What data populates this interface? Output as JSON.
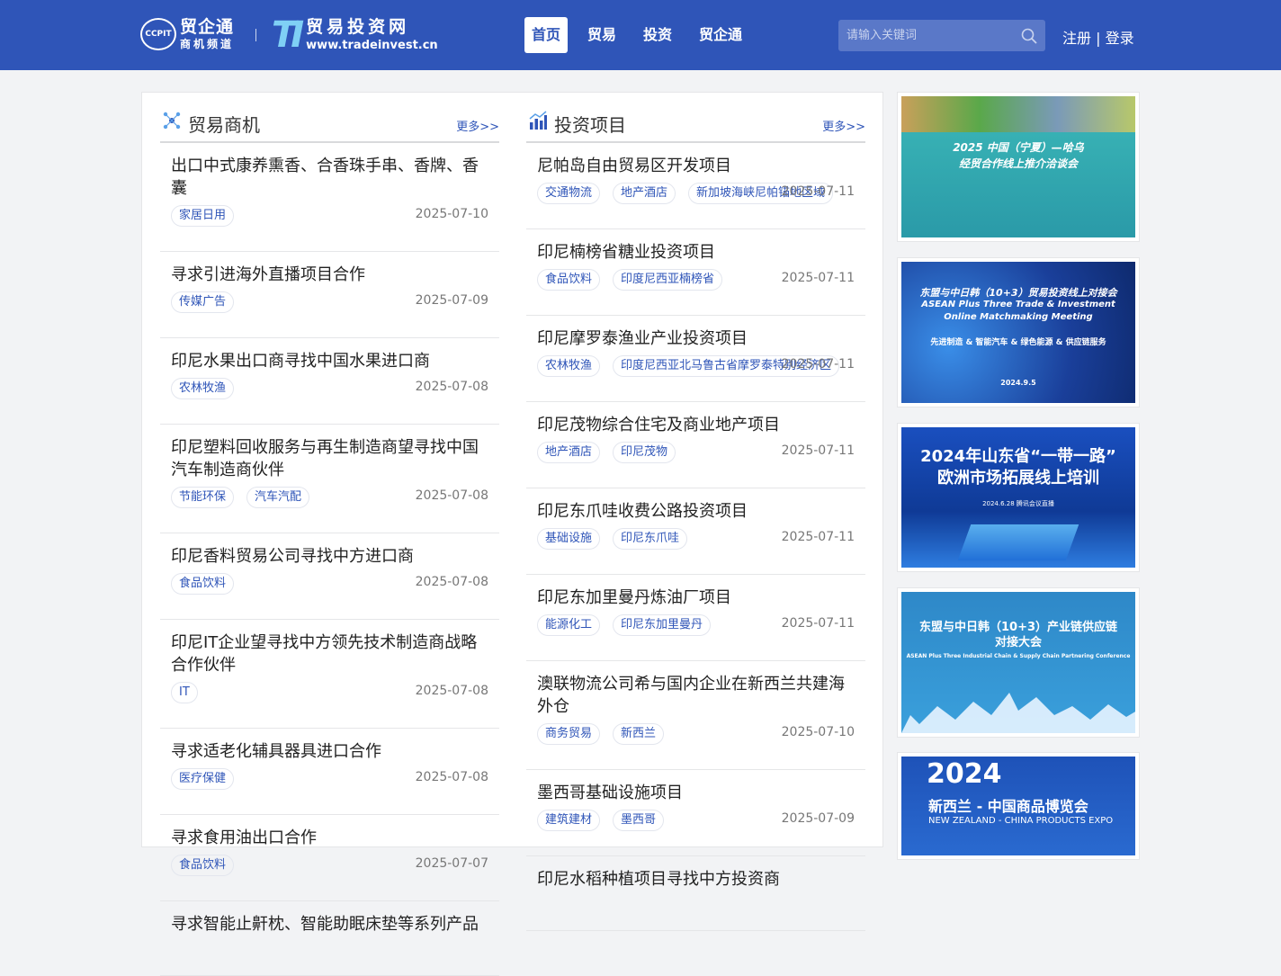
{
  "header": {
    "logo1_title": "贸企通",
    "logo1_sub": "商机频道",
    "logo1_badge": "CCPIT",
    "logo2_mark": "TI",
    "logo2_title": "贸易投资网",
    "logo2_url": "www.tradeinvest.cn",
    "nav": [
      "首页",
      "贸易",
      "投资",
      "贸企通"
    ],
    "search_placeholder": "请输入关键词",
    "register": "注册",
    "divider": "|",
    "login": "登录"
  },
  "trade": {
    "title": "贸易商机",
    "more": "更多>>",
    "items": [
      {
        "title": "出口中式康养熏香、合香珠手串、香牌、香囊",
        "tags": [
          "家居日用"
        ],
        "date": "2025-07-10"
      },
      {
        "title": "寻求引进海外直播项目合作",
        "tags": [
          "传媒广告"
        ],
        "date": "2025-07-09"
      },
      {
        "title": "印尼水果出口商寻找中国水果进口商",
        "tags": [
          "农林牧渔"
        ],
        "date": "2025-07-08"
      },
      {
        "title": "印尼塑料回收服务与再生制造商望寻找中国汽车制造商伙伴",
        "tags": [
          "节能环保",
          "汽车汽配"
        ],
        "date": "2025-07-08"
      },
      {
        "title": "印尼香料贸易公司寻找中方进口商",
        "tags": [
          "食品饮料"
        ],
        "date": "2025-07-08"
      },
      {
        "title": "印尼IT企业望寻找中方领先技术制造商战略合作伙伴",
        "tags": [
          "IT"
        ],
        "date": "2025-07-08"
      },
      {
        "title": "寻求适老化辅具器具进口合作",
        "tags": [
          "医疗保健"
        ],
        "date": "2025-07-08"
      },
      {
        "title": "寻求食用油出口合作",
        "tags": [
          "食品饮料"
        ],
        "date": "2025-07-07"
      },
      {
        "title": "寻求智能止鼾枕、智能助眠床垫等系列产品",
        "tags": [],
        "date": ""
      }
    ]
  },
  "invest": {
    "title": "投资项目",
    "more": "更多>>",
    "items": [
      {
        "title": "尼帕岛自由贸易区开发项目",
        "tags": [
          "交通物流",
          "地产酒店",
          "新加坡海峡尼帕锚地区域"
        ],
        "date": "2025-07-11"
      },
      {
        "title": "印尼楠榜省糖业投资项目",
        "tags": [
          "食品饮料",
          "印度尼西亚楠榜省"
        ],
        "date": "2025-07-11"
      },
      {
        "title": "印尼摩罗泰渔业产业投资项目",
        "tags": [
          "农林牧渔",
          "印度尼西亚北马鲁古省摩罗泰特别经济区"
        ],
        "date": "2025-07-11"
      },
      {
        "title": "印尼茂物综合住宅及商业地产项目",
        "tags": [
          "地产酒店",
          "印尼茂物"
        ],
        "date": "2025-07-11"
      },
      {
        "title": "印尼东爪哇收费公路投资项目",
        "tags": [
          "基础设施",
          "印尼东爪哇"
        ],
        "date": "2025-07-11"
      },
      {
        "title": "印尼东加里曼丹炼油厂项目",
        "tags": [
          "能源化工",
          "印尼东加里曼丹"
        ],
        "date": "2025-07-11"
      },
      {
        "title": "澳联物流公司希与国内企业在新西兰共建海外仓",
        "tags": [
          "商务贸易",
          "新西兰"
        ],
        "date": "2025-07-10"
      },
      {
        "title": "墨西哥基础设施项目",
        "tags": [
          "建筑建材",
          "墨西哥"
        ],
        "date": "2025-07-09"
      },
      {
        "title": "印尼水稻种植项目寻找中方投资商",
        "tags": [],
        "date": ""
      }
    ]
  },
  "banners": [
    {
      "line1": "2025 中国（宁夏）—哈乌",
      "line2": "经贸合作线上推介洽谈会",
      "bg": "#2ba3a8"
    },
    {
      "line1": "东盟与中日韩（10+3）贸易投资线上对接会",
      "line2": "ASEAN Plus Three Trade & Investment",
      "line3": "Online Matchmaking Meeting",
      "line4": "先进制造 & 智能汽车 & 绿色能源 & 供应链服务",
      "line5": "2024.9.5",
      "bg": "#1f4aa8"
    },
    {
      "line1": "2024年山东省“一带一路”",
      "line2": "欧洲市场拓展线上培训",
      "line3": "2024.6.28 腾讯会议直播",
      "bg": "#1a4fbf"
    },
    {
      "line1": "东盟与中日韩（10+3）产业链供应链",
      "line2": "对接大会",
      "line3": "ASEAN Plus Three Industrial Chain & Supply Chain Partnering Conference",
      "bg": "#2e88c8"
    },
    {
      "line1": "2024",
      "line2": "新西兰 - 中国商品博览会",
      "line3": "NEW ZEALAND - CHINA PRODUCTS EXPO",
      "bg": "#1e52b8"
    }
  ],
  "colors": {
    "brand": "#2f55b8",
    "link": "#2f55b8"
  }
}
